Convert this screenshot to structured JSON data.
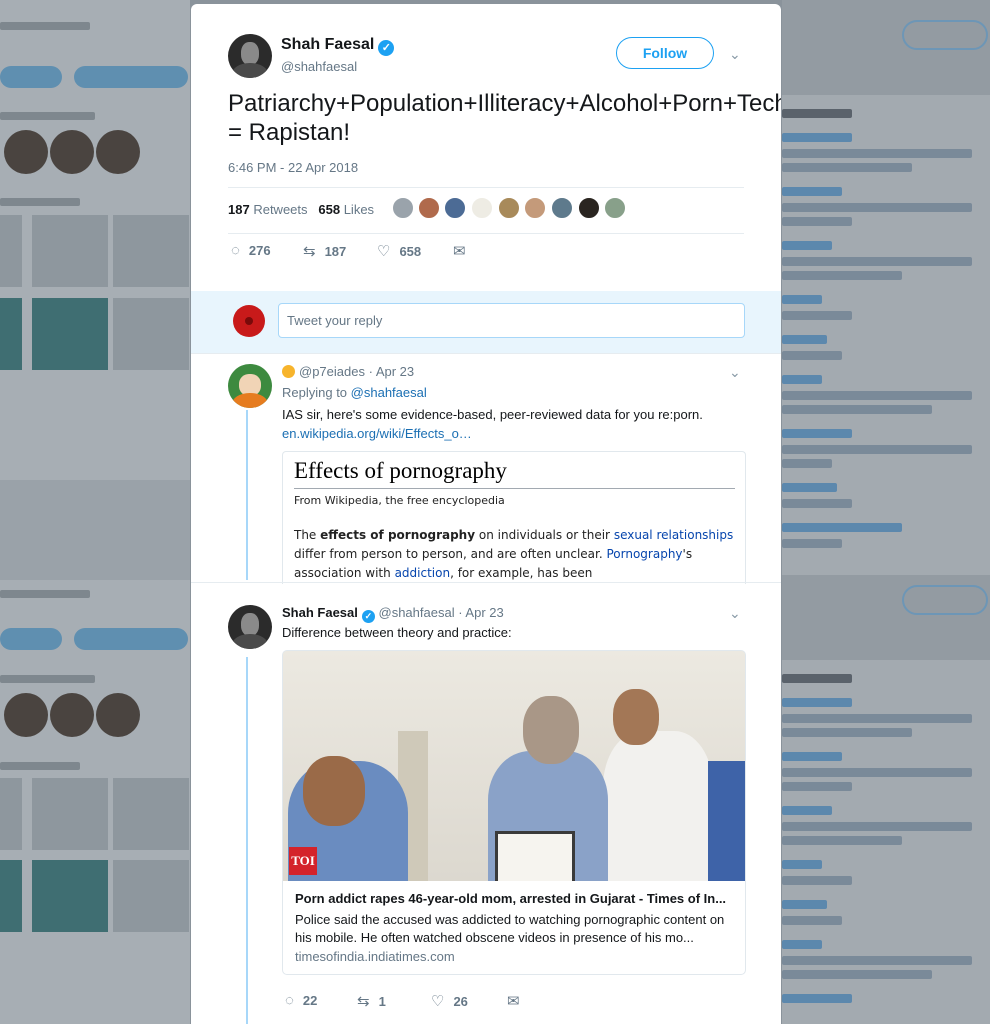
{
  "main_tweet": {
    "author_name": "Shah Faesal",
    "author_handle": "@shahfaesal",
    "follow_label": "Follow",
    "text": "Patriarchy+Population+Illiteracy+Alcohol+Porn+Technology+Anarchy = Rapistan!",
    "timestamp": "6:46 PM - 22 Apr 2018",
    "retweets_count": "187",
    "retweets_label": "Retweets",
    "likes_count": "658",
    "likes_label": "Likes",
    "actions": {
      "replies": "276",
      "retweets": "187",
      "likes": "658"
    }
  },
  "reply_box": {
    "placeholder": "Tweet your reply"
  },
  "reply1": {
    "handle": "@p7eiades",
    "date": "· Apr 23",
    "replying_prefix": "Replying to",
    "replying_to": "@shahfaesal",
    "text": "IAS sir, here's some evidence-based, peer-reviewed data for you re:porn.",
    "link": "en.wikipedia.org/wiki/Effects_o…",
    "wiki": {
      "title": "Effects of pornography",
      "subtitle": "From Wikipedia, the free encyclopedia",
      "b1": "The ",
      "b2": "effects of pornography",
      "b3": " on individuals or their ",
      "b4": "sexual relationships",
      "b5": " differ from person to person, and are often unclear. ",
      "b6": "Pornography",
      "b7": "'s association with ",
      "b8": "addiction",
      "b9": ", for example, has been"
    }
  },
  "reply2": {
    "author_name": "Shah Faesal",
    "handle": "@shahfaesal",
    "date": "· Apr 23",
    "text": "Difference between theory and practice:",
    "card": {
      "logo": "TOI",
      "headline": "Porn addict rapes 46-year-old mom, arrested in Gujarat - Times of In...",
      "description": "Police said the accused was addicted to watching pornographic content on his mobile. He often watched obscene videos in presence of his mo...",
      "domain": "timesofindia.indiatimes.com"
    },
    "actions": {
      "replies": "22",
      "retweets": "1",
      "likes": "26"
    }
  },
  "icons": {
    "reply": "reply-icon",
    "retweet": "retweet-icon",
    "like": "heart-icon",
    "message": "envelope-icon",
    "verified": "verified-badge-icon",
    "caret": "chevron-down-icon"
  },
  "colors": {
    "accent": "#1da1f2",
    "link": "#1b6fb3",
    "reply_bar": "#e8f5fd",
    "toi_red": "#d4232b"
  }
}
